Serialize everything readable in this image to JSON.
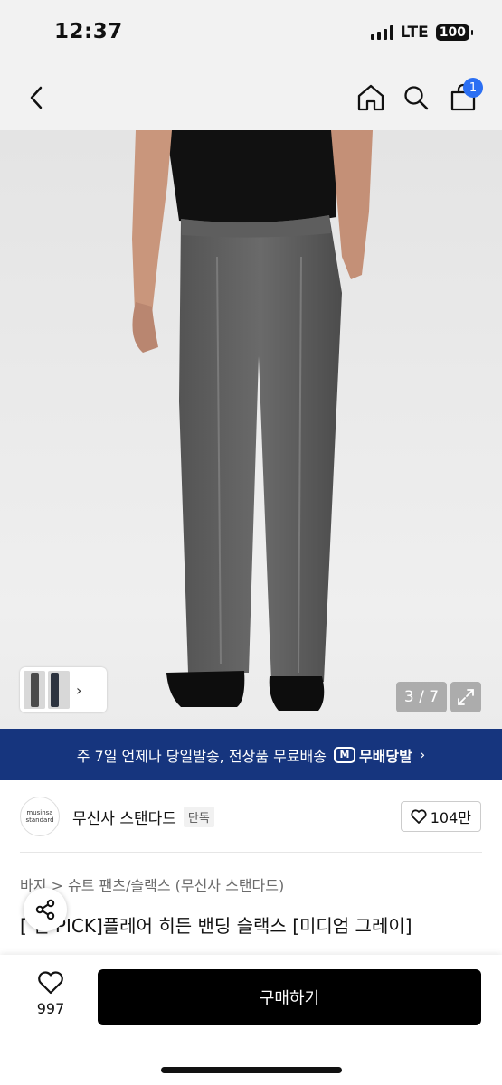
{
  "status_bar": {
    "time": "12:37",
    "network": "LTE",
    "battery": "100"
  },
  "nav": {
    "cart_badge": "1"
  },
  "gallery": {
    "counter": "3 / 7"
  },
  "banner": {
    "text": "주 7일 언제나 당일발송, 전상품 무료배송",
    "logo_badge": "M",
    "logo_text": "무배당발",
    "chevron": "›"
  },
  "brand": {
    "logo_line1": "musinsa",
    "logo_line2": "standard",
    "name": "무신사 스탠다드",
    "tag": "단독",
    "likes": "104만"
  },
  "product": {
    "breadcrumb": "바지 > 슈트 팬츠/슬랙스 (무신사 스탠다드)",
    "title": "[ 현 PICK]플레어 히든 밴딩 슬랙스 [미디엄 그레이]"
  },
  "bottom": {
    "wish_count": "997",
    "buy_label": "구매하기"
  }
}
